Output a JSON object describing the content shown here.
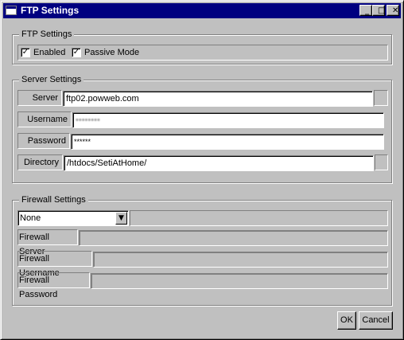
{
  "window": {
    "title": "FTP Settings",
    "minimize_glyph": "_",
    "maximize_glyph": "□",
    "close_glyph": "✕"
  },
  "ftp_group": {
    "legend": "FTP Settings",
    "enabled_label": "Enabled",
    "enabled_checked": true,
    "passive_label": "Passive Mode",
    "passive_checked": true,
    "check_glyph": "✓"
  },
  "server_group": {
    "legend": "Server Settings",
    "server_label": "Server",
    "server_value": "ftp02.powweb.com",
    "username_label": "Username",
    "username_value": "••••••••",
    "password_label": "Password",
    "password_value": "******",
    "directory_label": "Directory",
    "directory_value": "/htdocs/SetiAtHome/"
  },
  "firewall_group": {
    "legend": "Firewall Settings",
    "type_selected": "None",
    "dropdown_glyph": "▼",
    "server_label": "Firewall Server",
    "server_value": "",
    "username_label": "Firewall Username",
    "username_value": "",
    "password_label": "Firewall Password",
    "password_value": ""
  },
  "buttons": {
    "ok_label": "OK",
    "cancel_label": "Cancel"
  }
}
